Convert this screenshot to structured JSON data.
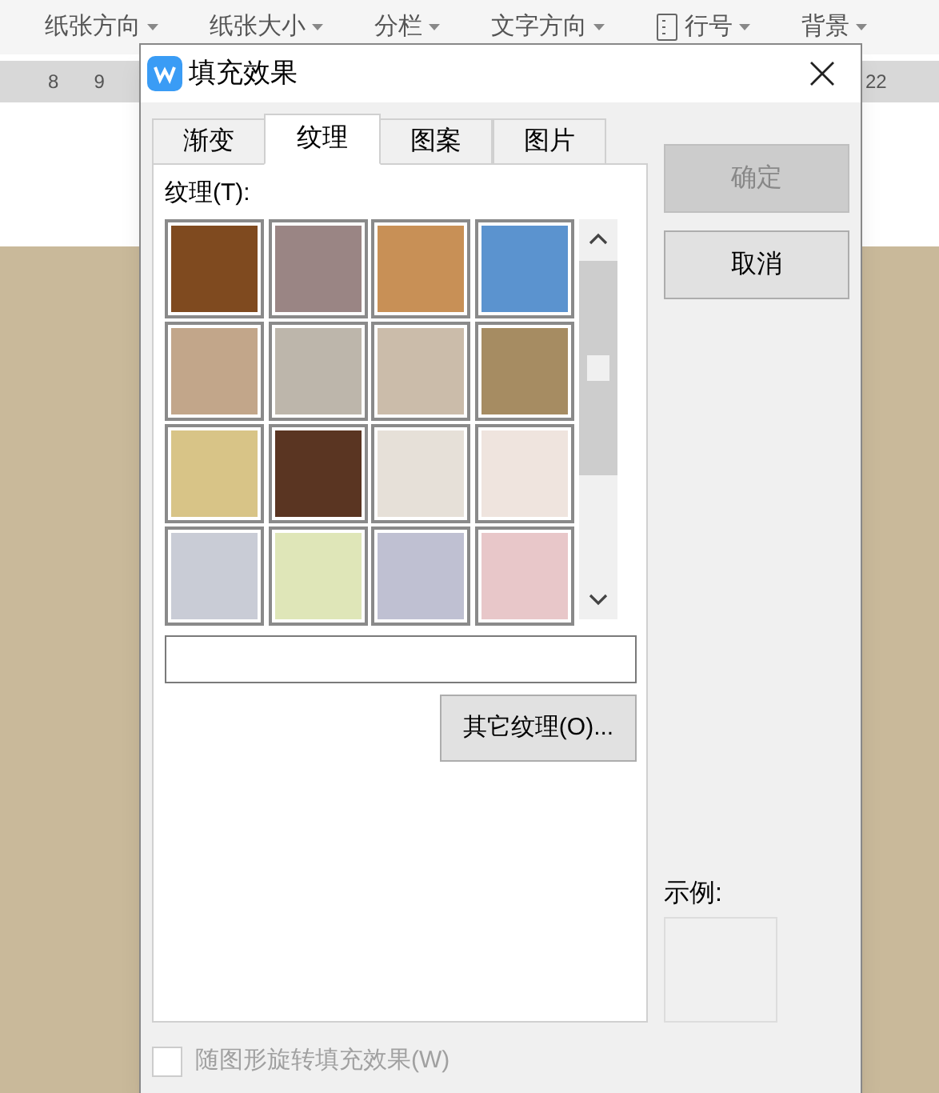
{
  "toolbar": {
    "items": [
      {
        "label": "纸张方向"
      },
      {
        "label": "纸张大小"
      },
      {
        "label": "分栏"
      },
      {
        "label": "文字方向"
      },
      {
        "label": "行号"
      },
      {
        "label": "背景"
      }
    ]
  },
  "ruler": {
    "left_marks": [
      "8",
      "9"
    ],
    "right_marks": [
      "22"
    ]
  },
  "dialog": {
    "title": "填充效果",
    "tabs": [
      {
        "label": "渐变",
        "selected": false
      },
      {
        "label": "纹理",
        "selected": true
      },
      {
        "label": "图案",
        "selected": false
      },
      {
        "label": "图片",
        "selected": false
      }
    ],
    "texture_label": "纹理(T):",
    "textures": [
      {
        "color": "#7f4a1f"
      },
      {
        "color": "#9a8584"
      },
      {
        "color": "#c89056"
      },
      {
        "color": "#5b93cf"
      },
      {
        "color": "#c2a68a"
      },
      {
        "color": "#bdb6ab"
      },
      {
        "color": "#cbbcaa"
      },
      {
        "color": "#a68c62"
      },
      {
        "color": "#d8c487"
      },
      {
        "color": "#5a3522"
      },
      {
        "color": "#e6e0d8"
      },
      {
        "color": "#efe4de"
      },
      {
        "color": "#c9ccd6"
      },
      {
        "color": "#dfe6b8"
      },
      {
        "color": "#bfc0d2"
      },
      {
        "color": "#e8c7c9"
      }
    ],
    "other_button": "其它纹理(O)...",
    "ok_button": {
      "label": "确定",
      "disabled": true
    },
    "cancel_button": {
      "label": "取消",
      "disabled": false
    },
    "sample_label": "示例:",
    "rotate_checkbox": {
      "label": "随图形旋转填充效果(W)",
      "checked": false,
      "disabled": true
    }
  }
}
